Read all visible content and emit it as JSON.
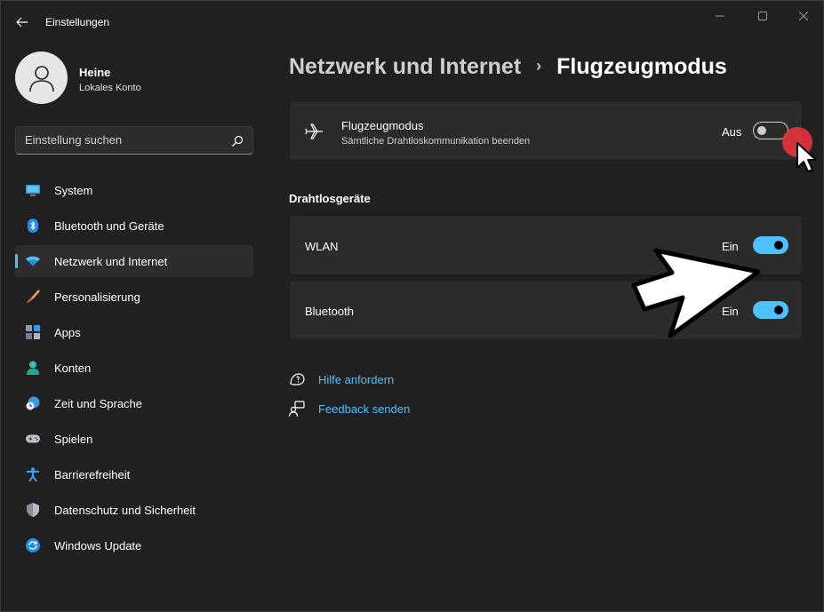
{
  "window": {
    "title": "Einstellungen"
  },
  "user": {
    "name": "Heine",
    "account_type": "Lokales Konto"
  },
  "search": {
    "placeholder": "Einstellung suchen"
  },
  "sidebar": {
    "items": [
      {
        "label": "System",
        "icon": "monitor-icon",
        "active": false
      },
      {
        "label": "Bluetooth und Geräte",
        "icon": "bluetooth-icon",
        "active": false
      },
      {
        "label": "Netzwerk und Internet",
        "icon": "wifi-icon",
        "active": true
      },
      {
        "label": "Personalisierung",
        "icon": "brush-icon",
        "active": false
      },
      {
        "label": "Apps",
        "icon": "apps-icon",
        "active": false
      },
      {
        "label": "Konten",
        "icon": "person-icon",
        "active": false
      },
      {
        "label": "Zeit und Sprache",
        "icon": "globe-clock-icon",
        "active": false
      },
      {
        "label": "Spielen",
        "icon": "gamepad-icon",
        "active": false
      },
      {
        "label": "Barrierefreiheit",
        "icon": "accessibility-icon",
        "active": false
      },
      {
        "label": "Datenschutz und Sicherheit",
        "icon": "shield-icon",
        "active": false
      },
      {
        "label": "Windows Update",
        "icon": "update-icon",
        "active": false
      }
    ]
  },
  "breadcrumb": {
    "parent": "Netzwerk und Internet",
    "separator": "›",
    "current": "Flugzeugmodus"
  },
  "airplane": {
    "title": "Flugzeugmodus",
    "description": "Sämtliche Drahtloskommunikation beenden",
    "state": "Aus",
    "on": false
  },
  "wireless": {
    "heading": "Drahtlosgeräte",
    "wlan": {
      "label": "WLAN",
      "state": "Ein",
      "on": true
    },
    "bluetooth": {
      "label": "Bluetooth",
      "state": "Ein",
      "on": true
    }
  },
  "links": {
    "help": "Hilfe anfordern",
    "feedback": "Feedback senden"
  },
  "colors": {
    "accent": "#4cc2ff",
    "background": "#202020",
    "card": "#2b2b2b",
    "click_marker": "#e5333b"
  }
}
